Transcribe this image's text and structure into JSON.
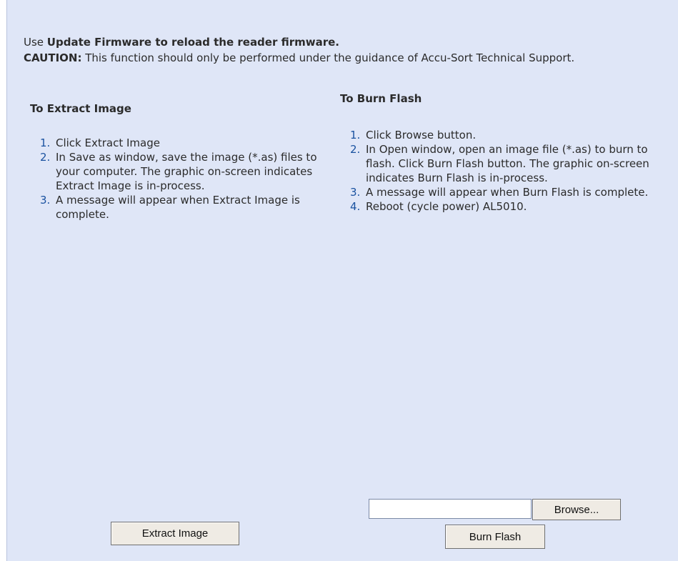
{
  "intro": {
    "use_prefix": "Use ",
    "use_bold": "Update Firmware to reload the reader firmware.",
    "caution_label": "CAUTION:",
    "caution_text": " This function should only be performed under the guidance of Accu-Sort Technical Support."
  },
  "extract": {
    "heading": "To Extract Image",
    "steps": [
      {
        "num": "1.",
        "text": "Click Extract Image"
      },
      {
        "num": "2.",
        "text": "In Save as window, save the image (*.as) files to your computer. The graphic on-screen indicates Extract Image is in-process."
      },
      {
        "num": "3.",
        "text": "A message will appear when Extract Image is complete."
      }
    ],
    "button_label": "Extract Image"
  },
  "burn": {
    "heading": "To Burn Flash",
    "steps": [
      {
        "num": "1.",
        "text": "Click Browse button."
      },
      {
        "num": "2.",
        "text": "In Open window, open an image file (*.as) to burn to flash. Click Burn Flash button. The graphic on-screen indicates Burn Flash is in-process."
      },
      {
        "num": "3.",
        "text": "A message will appear when Burn Flash is complete."
      },
      {
        "num": "4.",
        "text": "Reboot (cycle power) AL5010."
      }
    ],
    "file_value": "",
    "browse_label": "Browse...",
    "button_label": "Burn Flash"
  },
  "colors": {
    "panel_bg": "#dfe6f7",
    "step_number": "#1a52a0"
  }
}
